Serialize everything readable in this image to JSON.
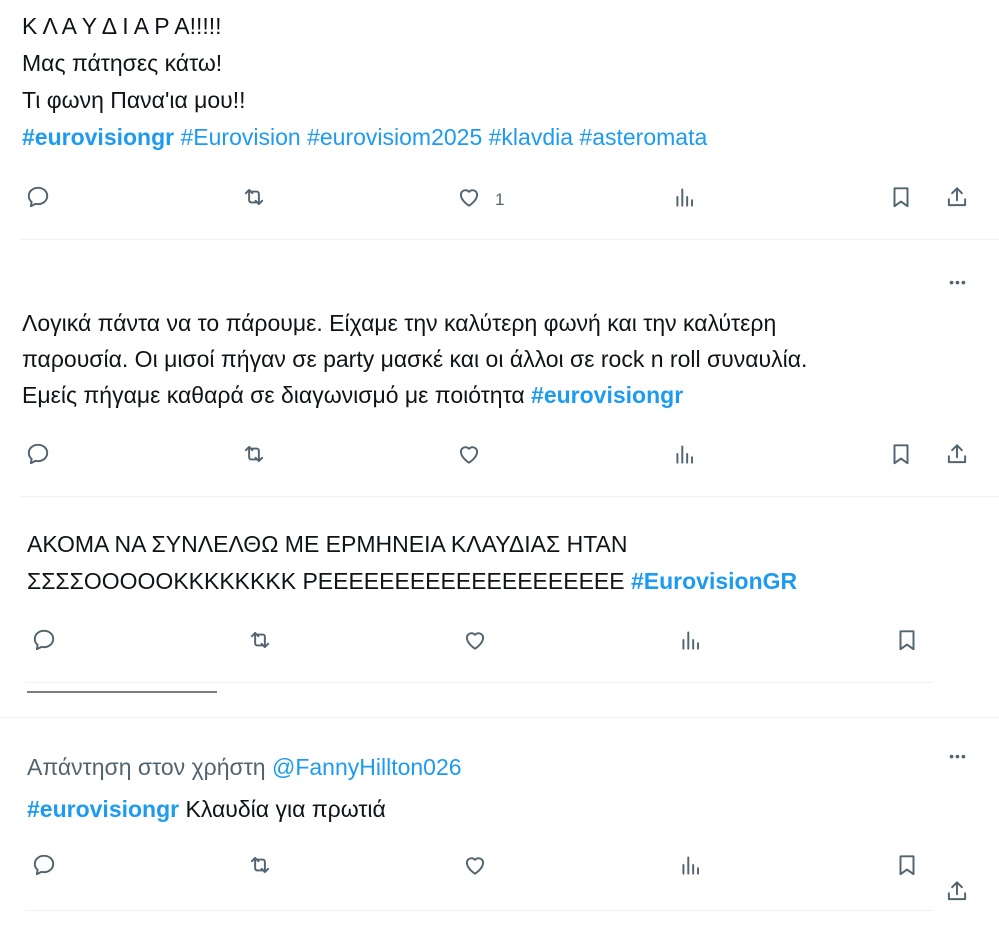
{
  "posts": [
    {
      "lines": [
        {
          "segments": [
            {
              "text": "Κ Λ Α Υ Δ Ι Α Ρ Α!!!!!",
              "type": "text"
            }
          ]
        },
        {
          "segments": [
            {
              "text": "Μας πάτησες κάτω!",
              "type": "text"
            }
          ]
        },
        {
          "segments": [
            {
              "text": "Τι φωνη Πανα'ια μου!!",
              "type": "text"
            }
          ]
        },
        {
          "segments": [
            {
              "text": "#eurovisiongr",
              "type": "hashtag-bold"
            },
            {
              "text": " ",
              "type": "text"
            },
            {
              "text": "#Eurovision",
              "type": "hashtag"
            },
            {
              "text": " ",
              "type": "text"
            },
            {
              "text": "#eurovisiom2025",
              "type": "hashtag"
            },
            {
              "text": " ",
              "type": "text"
            },
            {
              "text": "#klavdia",
              "type": "hashtag"
            },
            {
              "text": " ",
              "type": "text"
            },
            {
              "text": "#asteromata",
              "type": "hashtag"
            }
          ]
        }
      ],
      "like_count": "1"
    },
    {
      "lines": [
        {
          "segments": [
            {
              "text": "Λογικά πάντα να το πάρουμε. Είχαμε την καλύτερη φωνή και την καλύτερη",
              "type": "text"
            }
          ]
        },
        {
          "segments": [
            {
              "text": "παρουσία. Οι μισοί πήγαν σε party μασκέ και οι άλλοι σε rock n roll συναυλία.",
              "type": "text"
            }
          ]
        },
        {
          "segments": [
            {
              "text": "Εμείς πήγαμε καθαρά σε διαγωνισμό με ποιότητα ",
              "type": "text"
            },
            {
              "text": "#eurovisiongr",
              "type": "hashtag-bold"
            }
          ]
        }
      ]
    },
    {
      "lines": [
        {
          "segments": [
            {
              "text": "ΑΚΟΜΑ ΝΑ ΣΥΝΛΕΛΘΩ ΜΕ ΕΡΜΗΝΕΙΑ ΚΛΑΥΔΙΑΣ ΗΤΑΝ",
              "type": "text"
            }
          ]
        },
        {
          "segments": [
            {
              "text": "ΣΣΣΣΟΟΟΟΟΚΚΚΚΚΚΚΚ ΡΕΕΕΕΕΕΕΕΕΕΕΕΕΕΕΕΕΕΕΕ ",
              "type": "text"
            },
            {
              "text": "#EurovisionGR",
              "type": "hashtag-bold"
            }
          ]
        }
      ]
    },
    {
      "reply_prefix": "Απάντηση στον χρήστη ",
      "reply_handle": "@FannyHillton026",
      "lines": [
        {
          "segments": [
            {
              "text": "#eurovisiongr",
              "type": "hashtag-bold"
            },
            {
              "text": " Κλαυδία για πρωτιά",
              "type": "text"
            }
          ]
        }
      ]
    }
  ],
  "more_glyph": "•••",
  "icons": [
    "reply-icon",
    "repost-icon",
    "like-icon",
    "views-icon",
    "bookmark-icon",
    "share-icon",
    "more-icon"
  ],
  "colors": {
    "text": "#0f1419",
    "link": "#1d9bf0",
    "muted": "#536471",
    "divider": "#eff3f4"
  }
}
